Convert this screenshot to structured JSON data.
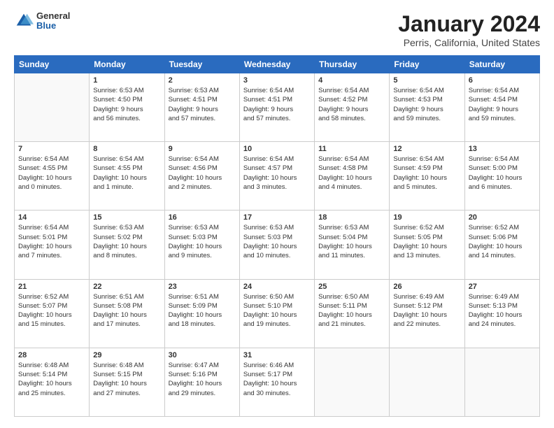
{
  "logo": {
    "general": "General",
    "blue": "Blue"
  },
  "header": {
    "month_year": "January 2024",
    "location": "Perris, California, United States"
  },
  "weekdays": [
    "Sunday",
    "Monday",
    "Tuesday",
    "Wednesday",
    "Thursday",
    "Friday",
    "Saturday"
  ],
  "weeks": [
    [
      {
        "day": "",
        "info": ""
      },
      {
        "day": "1",
        "info": "Sunrise: 6:53 AM\nSunset: 4:50 PM\nDaylight: 9 hours\nand 56 minutes."
      },
      {
        "day": "2",
        "info": "Sunrise: 6:53 AM\nSunset: 4:51 PM\nDaylight: 9 hours\nand 57 minutes."
      },
      {
        "day": "3",
        "info": "Sunrise: 6:54 AM\nSunset: 4:51 PM\nDaylight: 9 hours\nand 57 minutes."
      },
      {
        "day": "4",
        "info": "Sunrise: 6:54 AM\nSunset: 4:52 PM\nDaylight: 9 hours\nand 58 minutes."
      },
      {
        "day": "5",
        "info": "Sunrise: 6:54 AM\nSunset: 4:53 PM\nDaylight: 9 hours\nand 59 minutes."
      },
      {
        "day": "6",
        "info": "Sunrise: 6:54 AM\nSunset: 4:54 PM\nDaylight: 9 hours\nand 59 minutes."
      }
    ],
    [
      {
        "day": "7",
        "info": "Sunrise: 6:54 AM\nSunset: 4:55 PM\nDaylight: 10 hours\nand 0 minutes."
      },
      {
        "day": "8",
        "info": "Sunrise: 6:54 AM\nSunset: 4:55 PM\nDaylight: 10 hours\nand 1 minute."
      },
      {
        "day": "9",
        "info": "Sunrise: 6:54 AM\nSunset: 4:56 PM\nDaylight: 10 hours\nand 2 minutes."
      },
      {
        "day": "10",
        "info": "Sunrise: 6:54 AM\nSunset: 4:57 PM\nDaylight: 10 hours\nand 3 minutes."
      },
      {
        "day": "11",
        "info": "Sunrise: 6:54 AM\nSunset: 4:58 PM\nDaylight: 10 hours\nand 4 minutes."
      },
      {
        "day": "12",
        "info": "Sunrise: 6:54 AM\nSunset: 4:59 PM\nDaylight: 10 hours\nand 5 minutes."
      },
      {
        "day": "13",
        "info": "Sunrise: 6:54 AM\nSunset: 5:00 PM\nDaylight: 10 hours\nand 6 minutes."
      }
    ],
    [
      {
        "day": "14",
        "info": "Sunrise: 6:54 AM\nSunset: 5:01 PM\nDaylight: 10 hours\nand 7 minutes."
      },
      {
        "day": "15",
        "info": "Sunrise: 6:53 AM\nSunset: 5:02 PM\nDaylight: 10 hours\nand 8 minutes."
      },
      {
        "day": "16",
        "info": "Sunrise: 6:53 AM\nSunset: 5:03 PM\nDaylight: 10 hours\nand 9 minutes."
      },
      {
        "day": "17",
        "info": "Sunrise: 6:53 AM\nSunset: 5:03 PM\nDaylight: 10 hours\nand 10 minutes."
      },
      {
        "day": "18",
        "info": "Sunrise: 6:53 AM\nSunset: 5:04 PM\nDaylight: 10 hours\nand 11 minutes."
      },
      {
        "day": "19",
        "info": "Sunrise: 6:52 AM\nSunset: 5:05 PM\nDaylight: 10 hours\nand 13 minutes."
      },
      {
        "day": "20",
        "info": "Sunrise: 6:52 AM\nSunset: 5:06 PM\nDaylight: 10 hours\nand 14 minutes."
      }
    ],
    [
      {
        "day": "21",
        "info": "Sunrise: 6:52 AM\nSunset: 5:07 PM\nDaylight: 10 hours\nand 15 minutes."
      },
      {
        "day": "22",
        "info": "Sunrise: 6:51 AM\nSunset: 5:08 PM\nDaylight: 10 hours\nand 17 minutes."
      },
      {
        "day": "23",
        "info": "Sunrise: 6:51 AM\nSunset: 5:09 PM\nDaylight: 10 hours\nand 18 minutes."
      },
      {
        "day": "24",
        "info": "Sunrise: 6:50 AM\nSunset: 5:10 PM\nDaylight: 10 hours\nand 19 minutes."
      },
      {
        "day": "25",
        "info": "Sunrise: 6:50 AM\nSunset: 5:11 PM\nDaylight: 10 hours\nand 21 minutes."
      },
      {
        "day": "26",
        "info": "Sunrise: 6:49 AM\nSunset: 5:12 PM\nDaylight: 10 hours\nand 22 minutes."
      },
      {
        "day": "27",
        "info": "Sunrise: 6:49 AM\nSunset: 5:13 PM\nDaylight: 10 hours\nand 24 minutes."
      }
    ],
    [
      {
        "day": "28",
        "info": "Sunrise: 6:48 AM\nSunset: 5:14 PM\nDaylight: 10 hours\nand 25 minutes."
      },
      {
        "day": "29",
        "info": "Sunrise: 6:48 AM\nSunset: 5:15 PM\nDaylight: 10 hours\nand 27 minutes."
      },
      {
        "day": "30",
        "info": "Sunrise: 6:47 AM\nSunset: 5:16 PM\nDaylight: 10 hours\nand 29 minutes."
      },
      {
        "day": "31",
        "info": "Sunrise: 6:46 AM\nSunset: 5:17 PM\nDaylight: 10 hours\nand 30 minutes."
      },
      {
        "day": "",
        "info": ""
      },
      {
        "day": "",
        "info": ""
      },
      {
        "day": "",
        "info": ""
      }
    ]
  ]
}
